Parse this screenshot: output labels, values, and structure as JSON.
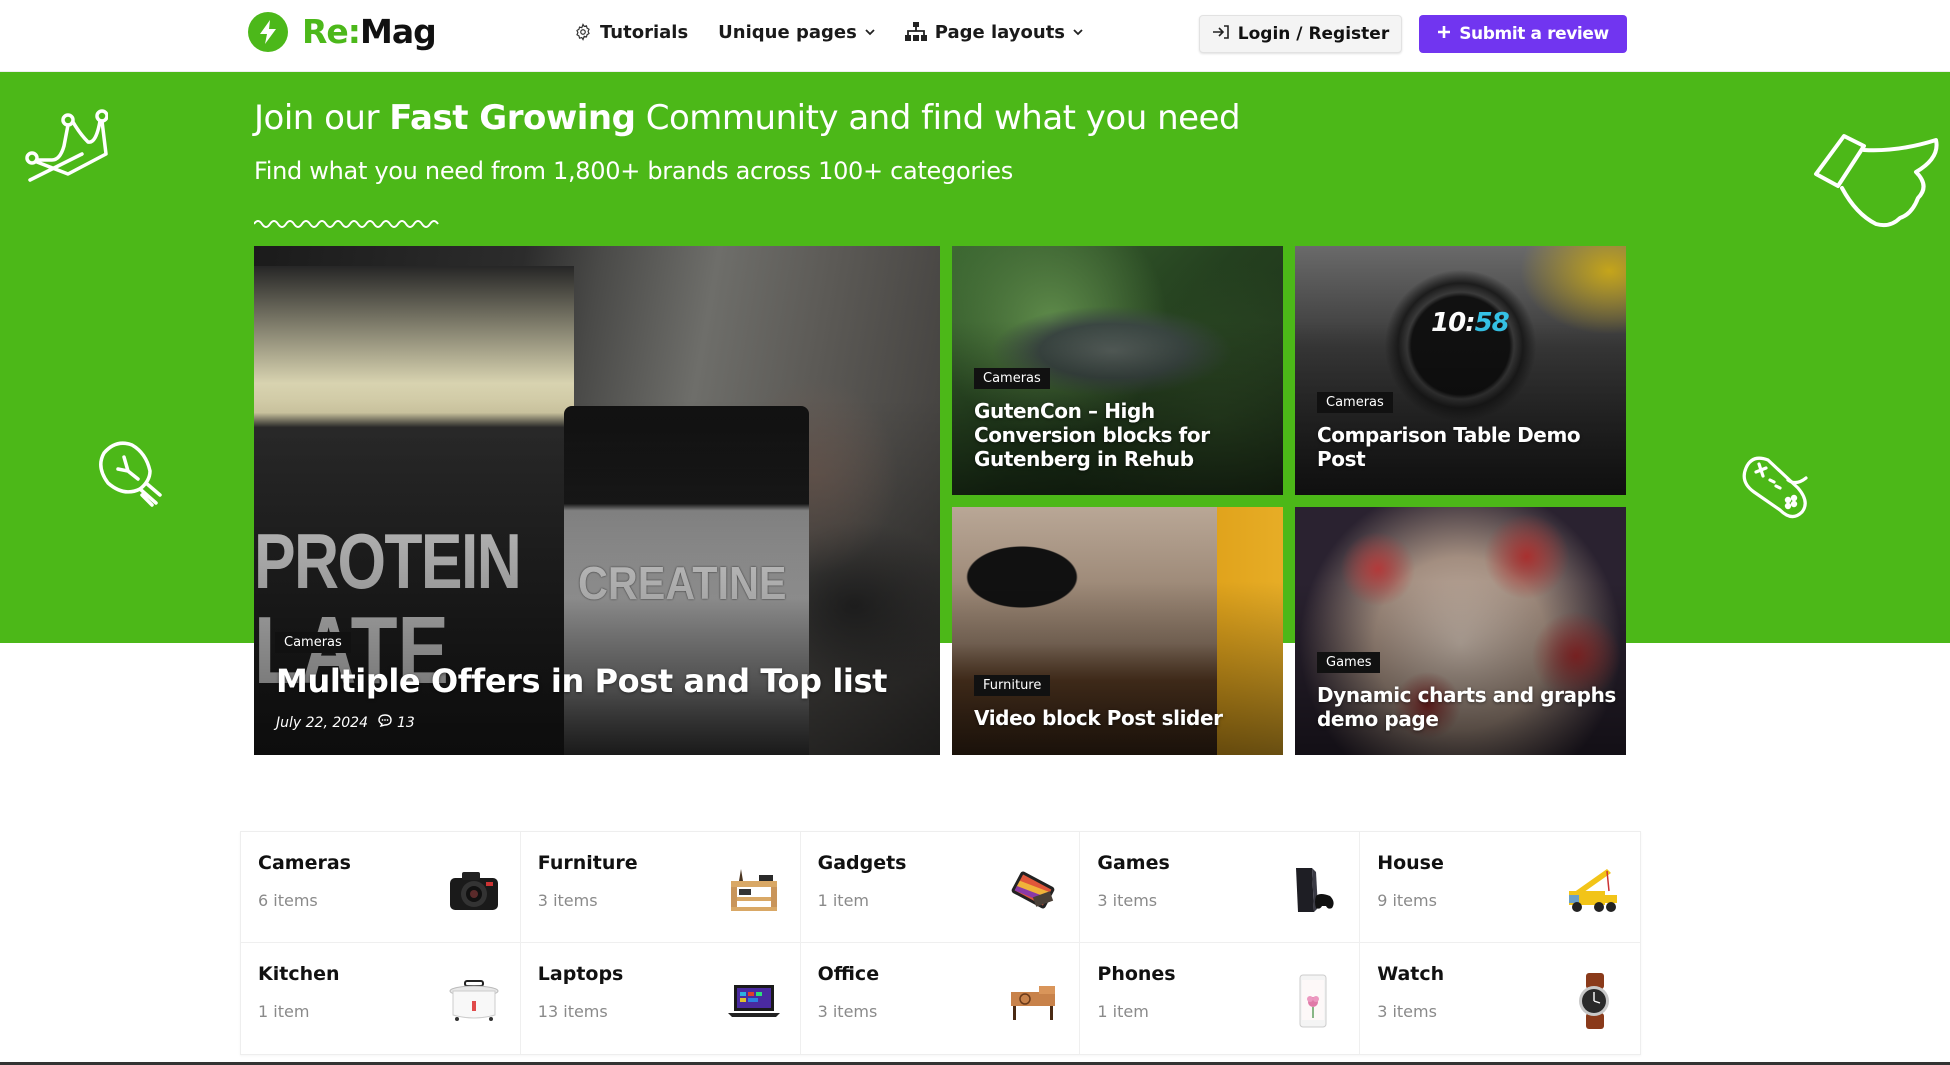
{
  "brand": {
    "prefix": "Re:",
    "name": "Mag",
    "accent": "#4cb81a"
  },
  "nav": {
    "items": [
      {
        "label": "Tutorials",
        "icon": "gear-icon",
        "dropdown": false
      },
      {
        "label": "Unique pages",
        "icon": "",
        "dropdown": true
      },
      {
        "label": "Page layouts",
        "icon": "sitemap-icon",
        "dropdown": true
      }
    ],
    "login_label": "Login / Register",
    "submit_label": "Submit a review",
    "submit_color": "#7135f0"
  },
  "hero": {
    "title_pre": "Join our ",
    "title_bold": "Fast Growing",
    "title_post": " Community and find what you need",
    "subtitle": "Find what you need from 1,800+ brands across 100+ categories",
    "band_color": "#4cb818",
    "decorations": [
      "crown-icon",
      "lightbulb-icon",
      "thumbs-up-icon",
      "gamepad-icon"
    ]
  },
  "featured": {
    "main": {
      "category": "Cameras",
      "title": "Multiple Offers in Post and Top list",
      "date": "July 22, 2024",
      "comments": "13",
      "image_text_1": "PROTEIN",
      "image_text_2": "LATE",
      "image_text_3": "CREATINE"
    },
    "cards": [
      {
        "category": "Cameras",
        "title": "GutenCon – High Conversion blocks for Gutenberg in Rehub"
      },
      {
        "category": "Cameras",
        "title": "Comparison Table Demo Post",
        "watch_hour": "10:",
        "watch_min": "58"
      },
      {
        "category": "Furniture",
        "title": "Video block Post slider"
      },
      {
        "category": "Games",
        "title": "Dynamic charts and graphs demo page"
      }
    ]
  },
  "categories": [
    {
      "name": "Cameras",
      "count": "6 items",
      "image": "camera"
    },
    {
      "name": "Furniture",
      "count": "3 items",
      "image": "furniture"
    },
    {
      "name": "Gadgets",
      "count": "1 item",
      "image": "gadget"
    },
    {
      "name": "Games",
      "count": "3 items",
      "image": "console"
    },
    {
      "name": "House",
      "count": "9 items",
      "image": "crane-truck"
    },
    {
      "name": "Kitchen",
      "count": "1 item",
      "image": "rice-cooker"
    },
    {
      "name": "Laptops",
      "count": "13 items",
      "image": "laptop"
    },
    {
      "name": "Office",
      "count": "3 items",
      "image": "laptop-table"
    },
    {
      "name": "Phones",
      "count": "1 item",
      "image": "phone"
    },
    {
      "name": "Watch",
      "count": "3 items",
      "image": "wristwatch"
    }
  ]
}
